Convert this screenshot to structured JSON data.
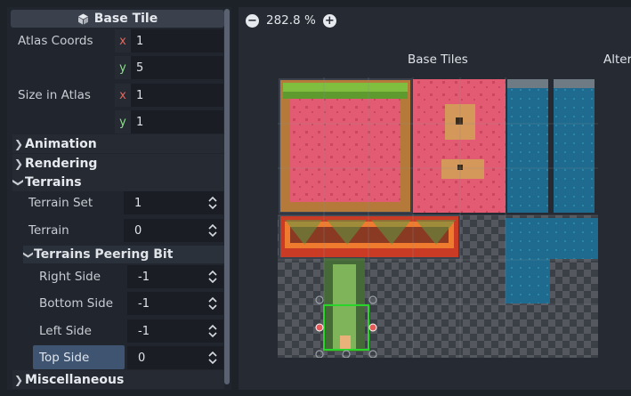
{
  "inspector": {
    "header": {
      "title": "Base Tile",
      "icon": "cube-icon"
    },
    "atlas_coords": {
      "label": "Atlas Coords",
      "x_axis": "x",
      "x": "1",
      "y_axis": "y",
      "y": "5"
    },
    "size_in_atlas": {
      "label": "Size in Atlas",
      "x_axis": "x",
      "x": "1",
      "y_axis": "y",
      "y": "1"
    },
    "sections": {
      "animation": "Animation",
      "rendering": "Rendering",
      "terrains": "Terrains",
      "misc": "Miscellaneous"
    },
    "terrain_set": {
      "label": "Terrain Set",
      "value": "1"
    },
    "terrain": {
      "label": "Terrain",
      "value": "0"
    },
    "peering": {
      "title": "Terrains Peering Bit",
      "right": {
        "label": "Right Side",
        "value": "-1"
      },
      "bottom": {
        "label": "Bottom Side",
        "value": "-1"
      },
      "left": {
        "label": "Left Side",
        "value": "-1"
      },
      "top": {
        "label": "Top Side",
        "value": "0"
      }
    }
  },
  "viewport": {
    "zoom_out_icon": "minus-icon",
    "zoom_in_icon": "plus-icon",
    "zoom": "282.8 %",
    "base_tiles_label": "Base Tiles",
    "alternative_label": "Alter"
  },
  "colors": {
    "accent": "#4a6d9e",
    "selection": "#2ad52a",
    "grass": "#7fbe3f",
    "pink": "#e35b72",
    "water": "#1f6b8f"
  }
}
